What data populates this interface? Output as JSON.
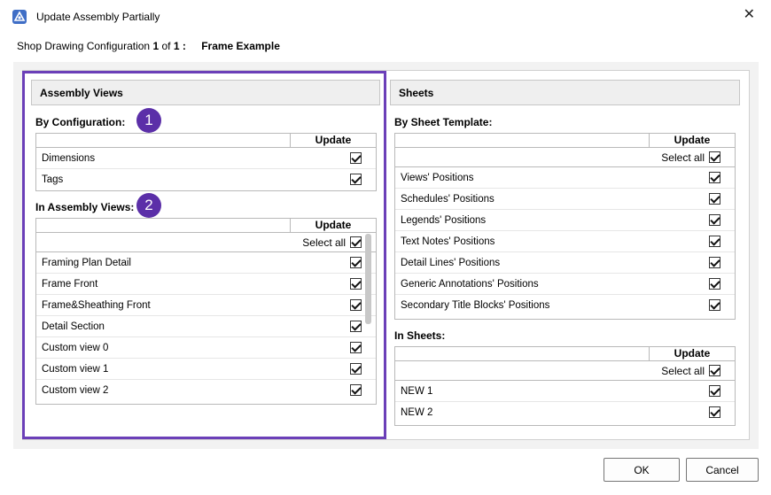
{
  "window": {
    "title": "Update Assembly Partially",
    "close_glyph": "✕"
  },
  "config": {
    "prefix": "Shop Drawing Configuration",
    "current": "1",
    "of_text": "of",
    "total": "1 :",
    "name": "Frame Example"
  },
  "left": {
    "header": "Assembly Views",
    "by_config": {
      "label": "By Configuration:",
      "badge": "1",
      "column": "Update",
      "rows": [
        {
          "label": "Dimensions"
        },
        {
          "label": "Tags"
        }
      ]
    },
    "in_views": {
      "label": "In Assembly Views:",
      "badge": "2",
      "column": "Update",
      "select_all": "Select all",
      "rows": [
        {
          "label": "Framing Plan Detail"
        },
        {
          "label": "Frame Front"
        },
        {
          "label": "Frame&Sheathing Front"
        },
        {
          "label": "Detail Section"
        },
        {
          "label": "Custom view 0"
        },
        {
          "label": "Custom view 1"
        },
        {
          "label": "Custom view 2"
        }
      ]
    }
  },
  "right": {
    "header": "Sheets",
    "by_template": {
      "label": "By Sheet Template:",
      "column": "Update",
      "select_all": "Select all",
      "rows": [
        {
          "label": "Views' Positions"
        },
        {
          "label": "Schedules' Positions"
        },
        {
          "label": "Legends' Positions"
        },
        {
          "label": "Text Notes' Positions"
        },
        {
          "label": "Detail Lines' Positions"
        },
        {
          "label": "Generic Annotations' Positions"
        },
        {
          "label": "Secondary Title Blocks' Positions"
        }
      ]
    },
    "in_sheets": {
      "label": "In Sheets:",
      "column": "Update",
      "select_all": "Select all",
      "rows": [
        {
          "label": "NEW 1"
        },
        {
          "label": "NEW 2"
        }
      ]
    }
  },
  "buttons": {
    "ok": "OK",
    "cancel": "Cancel"
  },
  "colors": {
    "accent": "#6b3fb8",
    "badge": "#5b2fa8"
  }
}
